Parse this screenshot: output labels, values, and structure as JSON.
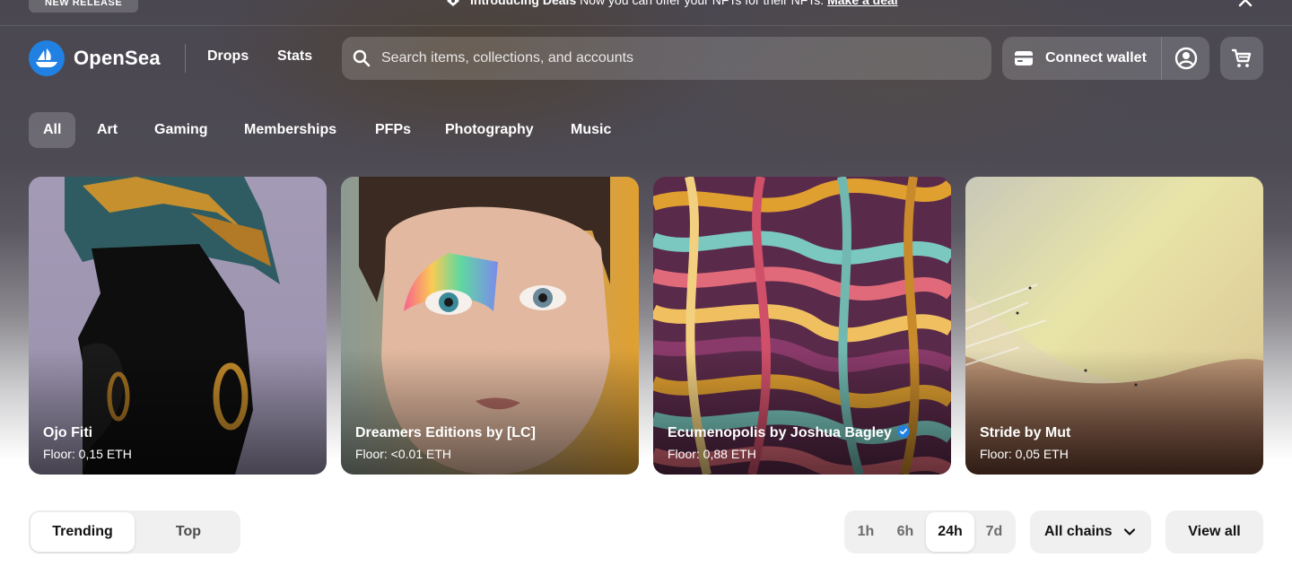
{
  "announcement": {
    "badge": "NEW RELEASE",
    "icon": "deal-tag-icon",
    "headline": "Introducing Deals",
    "body": "Now you can offer your NFTs for their NFTs.",
    "link": "Make a deal"
  },
  "navbar": {
    "brand": "OpenSea",
    "links": [
      "Drops",
      "Stats"
    ],
    "search_placeholder": "Search items, collections, and accounts",
    "connect_wallet": "Connect wallet"
  },
  "categories": {
    "items": [
      "All",
      "Art",
      "Gaming",
      "Memberships",
      "PFPs",
      "Photography",
      "Music"
    ],
    "active": "All"
  },
  "featured": [
    {
      "name": "Ojo Fiti",
      "floor": "Floor: 0,15 ETH",
      "verified": false
    },
    {
      "name": "Dreamers Editions by [LC]",
      "floor": "Floor: <0.01 ETH",
      "verified": false
    },
    {
      "name": "Ecumenopolis by Joshua Bagley",
      "floor": "Floor: 0,88 ETH",
      "verified": true
    },
    {
      "name": "Stride by Mut",
      "floor": "Floor: 0,05 ETH",
      "verified": false
    }
  ],
  "controls": {
    "trending": "Trending",
    "top": "Top",
    "ranges": [
      "1h",
      "6h",
      "24h",
      "7d"
    ],
    "active_range": "24h",
    "chains": "All chains",
    "view_all": "View all"
  },
  "colors": {
    "brand_blue": "#2081e2",
    "verified_blue": "#2081e2"
  }
}
